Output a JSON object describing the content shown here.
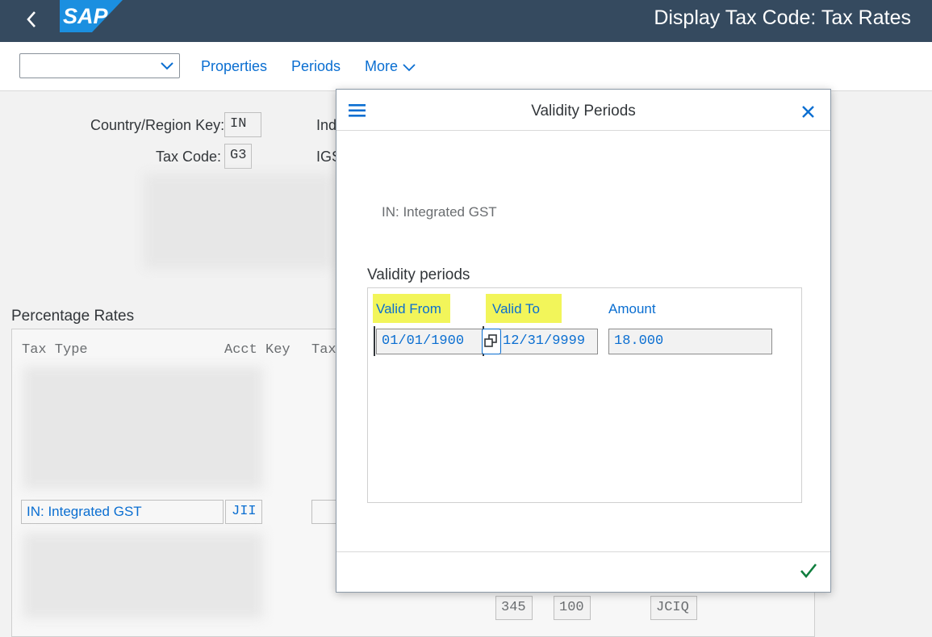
{
  "shell": {
    "logo_text": "SAP",
    "title": "Display Tax Code: Tax Rates"
  },
  "toolbar": {
    "variant_value": "",
    "properties": "Properties",
    "periods": "Periods",
    "more": "More"
  },
  "header": {
    "country_label": "Country/Region Key:",
    "country_value": "IN",
    "tax_code_label": "Tax Code:",
    "tax_code_value": "G3",
    "ind_partial": "Ind",
    "igs_partial": "IGS"
  },
  "rates": {
    "title": "Percentage Rates",
    "col_tax_type": "Tax Type",
    "col_acct_key": "Acct Key",
    "col_tax": "Tax",
    "visible_row": {
      "tax_type": "IN: Integrated GST",
      "acct_key": "JII"
    },
    "bottom_row": {
      "v1": "345",
      "v2": "100",
      "v3": "JCIQ"
    }
  },
  "dialog": {
    "title": "Validity Periods",
    "subtitle": "IN: Integrated GST",
    "section_label": "Validity periods",
    "columns": {
      "valid_from": "Valid From",
      "valid_to": "Valid To",
      "amount": "Amount"
    },
    "row": {
      "valid_from": "01/01/1900",
      "valid_to": "12/31/9999",
      "amount": "18.000"
    }
  },
  "colors": {
    "shell_bg": "#354a5f",
    "link_blue": "#0a6ed1",
    "highlight": "#f2f55a",
    "confirm_green": "#107e3e"
  }
}
